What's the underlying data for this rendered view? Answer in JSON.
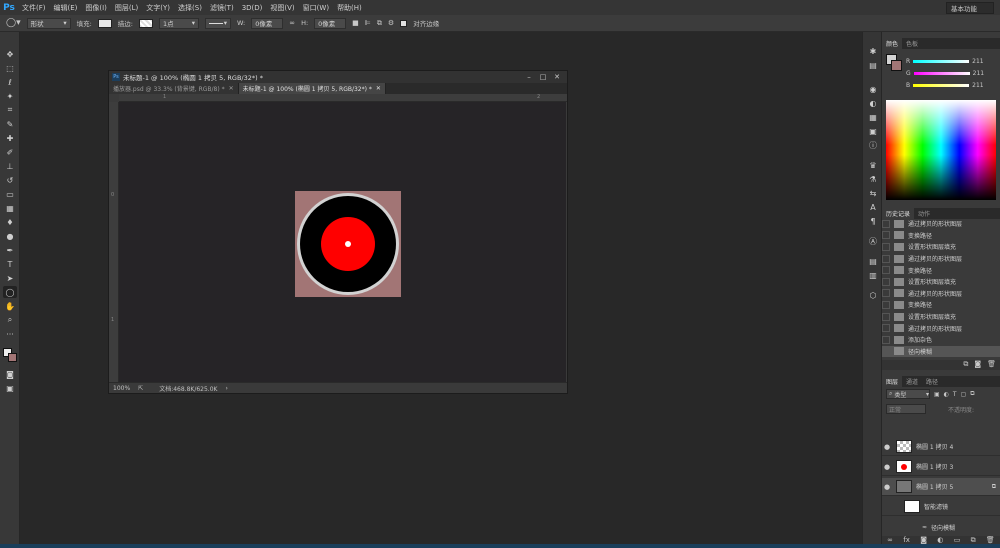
{
  "app": {
    "logo": "Ps"
  },
  "menu": [
    "文件(F)",
    "编辑(E)",
    "图像(I)",
    "图层(L)",
    "文字(Y)",
    "选择(S)",
    "滤镜(T)",
    "3D(D)",
    "视图(V)",
    "窗口(W)",
    "帮助(H)"
  ],
  "options": {
    "mode": "形状",
    "fill_label": "填充:",
    "stroke_label": "描边:",
    "stroke_size": "1点",
    "w_label": "W:",
    "w_value": "0像素",
    "h_label": "H:",
    "h_value": "0像素",
    "align_edges": "对齐边缘",
    "workspace": "基本功能"
  },
  "document": {
    "title": "未标题-1 @ 100% (椭圆 1 拷贝 5, RGB/32*) *",
    "tabs": [
      {
        "label": "播放器.psd @ 33.3% (背景键, RGB/8) *",
        "active": false
      },
      {
        "label": "未标题-1 @ 100% (椭圆 1 拷贝 5, RGB/32*) *",
        "active": true
      }
    ],
    "ruler_top": [
      "1",
      "2"
    ],
    "ruler_left": [
      "0",
      "1"
    ],
    "zoom": "100%",
    "doc_info": "文档:468.8K/625.0K"
  },
  "color_panel": {
    "tabs": [
      "颜色",
      "色板"
    ],
    "channels": [
      {
        "name": "R",
        "value": "211"
      },
      {
        "name": "G",
        "value": "211"
      },
      {
        "name": "B",
        "value": "211"
      }
    ]
  },
  "history_panel": {
    "tabs": [
      "历史记录",
      "动作"
    ],
    "items": [
      "通过拷贝的形状图层",
      "变换路径",
      "设置形状图层填充",
      "通过拷贝的形状图层",
      "变换路径",
      "设置形状图层填充",
      "通过拷贝的形状图层",
      "变换路径",
      "设置形状图层填充",
      "通过拷贝的形状图层",
      "添加杂色",
      "径向模糊"
    ]
  },
  "layers_panel": {
    "tabs": [
      "图层",
      "通道",
      "路径"
    ],
    "filter": "类型",
    "blend_mode": "正常",
    "opacity_label": "不透明度:",
    "layers": [
      {
        "name": "椭圆 1 拷贝 4"
      },
      {
        "name": "椭圆 1 拷贝 3"
      },
      {
        "name": "椭圆 1 拷贝 5"
      },
      {
        "name": "智能滤镜"
      },
      {
        "name": "径向模糊"
      }
    ]
  },
  "colors": {
    "accent_red": "#ff0000",
    "art_background": "#a27575",
    "ps_blue": "#31a8ff"
  }
}
